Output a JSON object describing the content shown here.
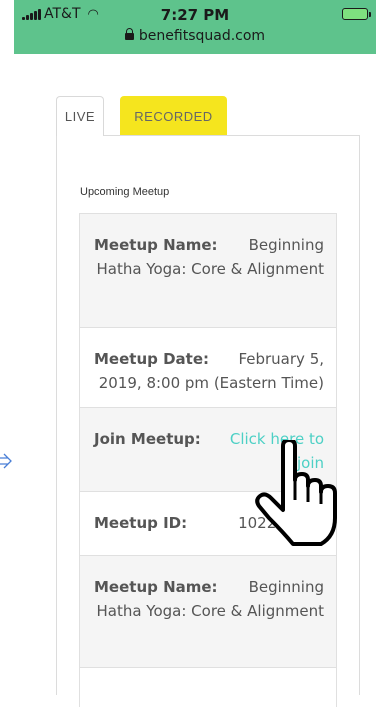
{
  "status_bar": {
    "carrier": "AT&T",
    "time": "7:27 PM",
    "url": "benefitsquad.com"
  },
  "tabs": [
    {
      "label": "LIVE"
    },
    {
      "label": "RECORDED"
    }
  ],
  "section_label": "Upcoming Meetup",
  "meetup": {
    "name_label": "Meetup Name:",
    "name_value": "Beginning Hatha Yoga: Core & Alignment",
    "date_label": "Meetup Date:",
    "date_value": "February 5, 2019, 8:00 pm (Eastern Time)",
    "join_label": "Join Meetup:",
    "join_link": "Click here to join",
    "id_label": "Meetup ID:",
    "id_value": "102243873"
  },
  "meetup2": {
    "name_label": "Meetup Name:",
    "name_value": "Beginning Hatha Yoga: Core & Alignment"
  },
  "colors": {
    "status_bar": "#5ec38c",
    "recorded_tab": "#f5e51e",
    "link": "#4dd0c5"
  }
}
